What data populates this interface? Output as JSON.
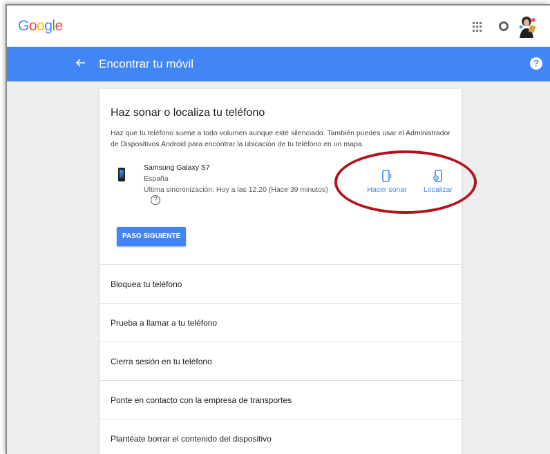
{
  "header": {
    "logo_letters": [
      "G",
      "o",
      "o",
      "g",
      "l",
      "e"
    ],
    "apps_icon": "apps-grid-icon",
    "notifications_icon": "notifications-icon"
  },
  "appbar": {
    "title": "Encontrar tu móvil",
    "back_icon": "arrow-left-icon",
    "help_icon": "help-icon",
    "help_glyph": "?",
    "color": "#4285F4"
  },
  "card": {
    "title": "Haz sonar o localiza tu teléfono",
    "description": "Haz que tu teléfono suene a todo volumen aunque esté silenciado. También puedes usar el Administrador de Dispositivos Android para encontrar la ubicación de tu teléfono en un mapa.",
    "device": {
      "name": "Samsung Galaxy S7",
      "country": "España",
      "sync": "Última sincronización: Hoy a las 12:20 (Hace 39 minutos)",
      "info_glyph": "?"
    },
    "actions": {
      "ring_label": "Hacer sonar",
      "locate_label": "Localizar"
    },
    "next_button": "PASO SIGUIENTE",
    "options": [
      "Bloquea tu teléfono",
      "Prueba a llamar a tu teléfono",
      "Cierra sesión en tu teléfono",
      "Ponte en contacto con la empresa de transportes",
      "Plantéate borrar el contenido del dispositivo"
    ]
  },
  "annotation_color": "#b3141b"
}
